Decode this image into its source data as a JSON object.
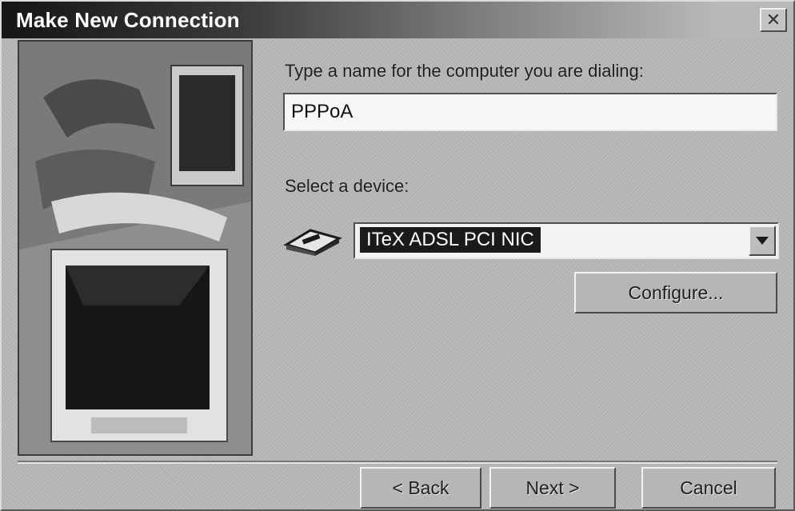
{
  "window": {
    "title": "Make New Connection",
    "close_glyph": "✕"
  },
  "form": {
    "name_label": "Type a name for the computer you are dialing:",
    "name_value": "PPPoA",
    "device_label": "Select a device:",
    "device_value": "ITeX ADSL PCI NIC",
    "device_icon": "modem-icon"
  },
  "buttons": {
    "configure": "Configure...",
    "back": "< Back",
    "next": "Next >",
    "cancel": "Cancel"
  },
  "colors": {
    "dialog_bg": "#b8b8b8",
    "titlebar_start": "#151515",
    "selection_bg": "#1a1a1a"
  }
}
